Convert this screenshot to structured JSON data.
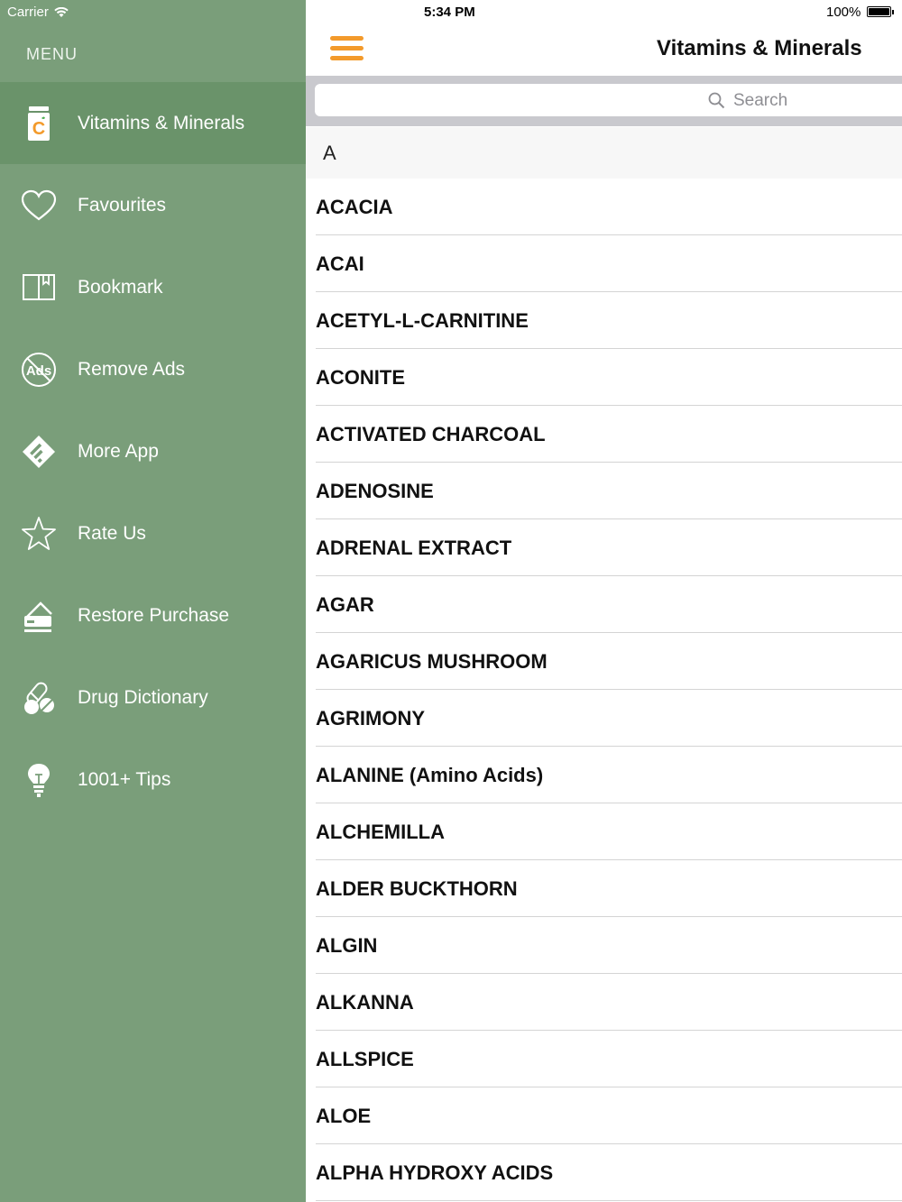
{
  "status_bar": {
    "carrier": "Carrier",
    "time": "5:34 PM",
    "battery": "100%"
  },
  "sidebar": {
    "title": "MENU",
    "items": [
      {
        "label": "Vitamins & Minerals",
        "icon": "vitamin-bottle-icon",
        "active": true
      },
      {
        "label": "Favourites",
        "icon": "heart-icon"
      },
      {
        "label": "Bookmark",
        "icon": "bookmark-book-icon"
      },
      {
        "label": "Remove Ads",
        "icon": "no-ads-icon"
      },
      {
        "label": "More App",
        "icon": "more-app-icon"
      },
      {
        "label": "Rate Us",
        "icon": "star-icon"
      },
      {
        "label": "Restore Purchase",
        "icon": "restore-purchase-icon"
      },
      {
        "label": "Drug Dictionary",
        "icon": "pills-icon"
      },
      {
        "label": "1001+ Tips",
        "icon": "lightbulb-icon"
      }
    ]
  },
  "main": {
    "title": "Vitamins & Minerals",
    "search_placeholder": "Search",
    "section_letter": "A",
    "items": [
      "ACACIA",
      "ACAI",
      "ACETYL-L-CARNITINE",
      "ACONITE",
      "ACTIVATED CHARCOAL",
      "ADENOSINE",
      "ADRENAL EXTRACT",
      "AGAR",
      "AGARICUS MUSHROOM",
      "AGRIMONY",
      "ALANINE (Amino Acids)",
      "ALCHEMILLA",
      "ALDER BUCKTHORN",
      "ALGIN",
      "ALKANNA",
      "ALLSPICE",
      "ALOE",
      "ALPHA HYDROXY ACIDS"
    ]
  },
  "colors": {
    "sidebar_bg": "#7a9e7a",
    "sidebar_active": "#6a936a",
    "accent": "#f39a2b"
  }
}
